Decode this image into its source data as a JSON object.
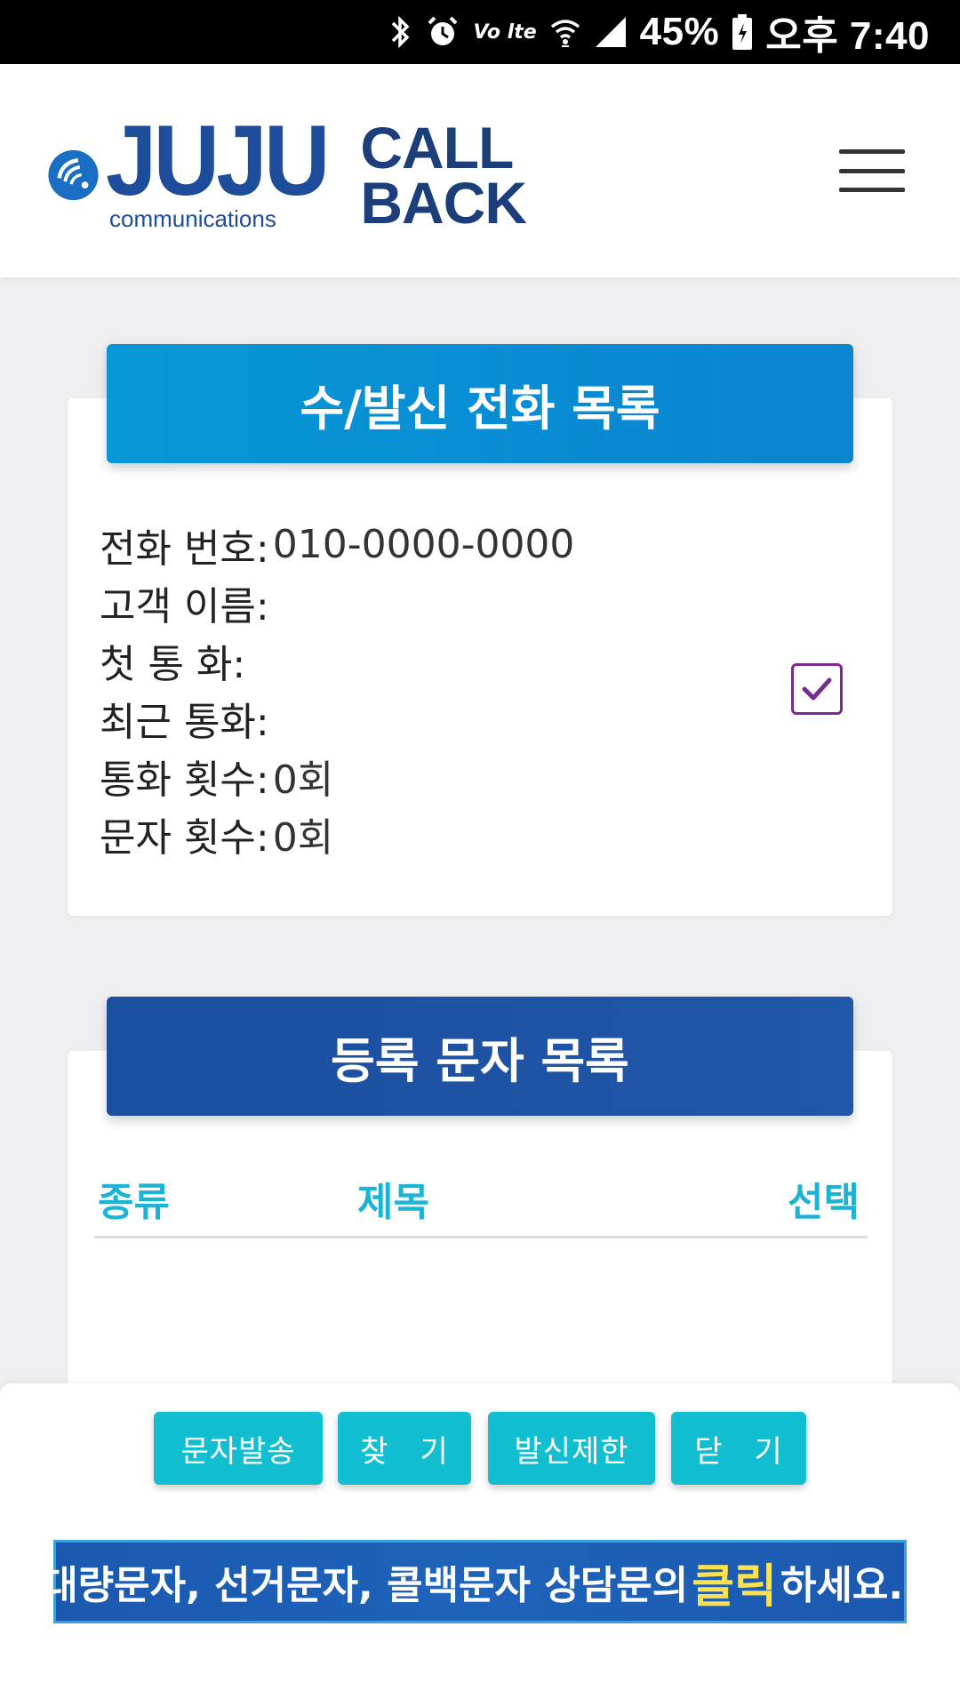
{
  "status_bar": {
    "battery": "45%",
    "time": "오후 7:40",
    "volte": "Vo lte",
    "icons": [
      "bluetooth-icon",
      "alarm-icon",
      "volte-icon",
      "wifi-icon",
      "signal-icon",
      "battery-icon"
    ]
  },
  "header": {
    "logo_brand": "JUJU",
    "logo_sub": "communications",
    "logo_call": "CALL",
    "logo_back": "BACK"
  },
  "call_card": {
    "title": "수/발신 전화 목록",
    "rows": [
      {
        "label": "전화 번호:",
        "value": "010-0000-0000"
      },
      {
        "label": "고객 이름:",
        "value": ""
      },
      {
        "label": "첫 통 화:",
        "value": ""
      },
      {
        "label": "최근 통화:",
        "value": ""
      },
      {
        "label": "통화 횟수:",
        "value": "0회"
      },
      {
        "label": "문자 횟수:",
        "value": "0회"
      }
    ],
    "checkbox_checked": true
  },
  "message_card": {
    "title": "등록 문자 목록",
    "columns": [
      "종류",
      "제목",
      "선택"
    ]
  },
  "buttons": {
    "send": "문자발송",
    "find": "찾　기",
    "block": "발신제한",
    "close": "닫　기"
  },
  "banner": {
    "pre": "대량문자, 선거문자, 콜백문자 상담문의",
    "highlight": "클릭",
    "post": "하세요.."
  },
  "colors": {
    "brand_blue": "#1c4c9a",
    "header_light": "#0797d8",
    "header_dark": "#1b4fa0",
    "button_cyan": "#12bfd1",
    "column_cyan": "#1bb3d6",
    "checkbox_purple": "#7a2b93"
  }
}
